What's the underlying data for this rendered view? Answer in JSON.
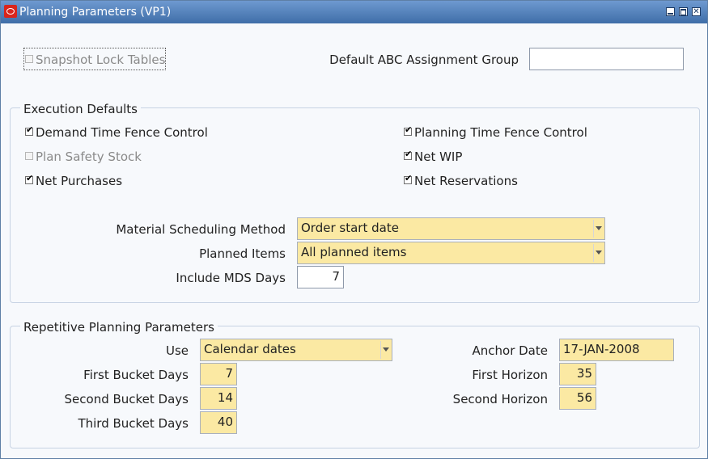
{
  "window": {
    "title": "Planning Parameters (VP1)"
  },
  "top": {
    "snapshot_lock_tables": {
      "label": "Snapshot Lock Tables",
      "checked": false
    },
    "abc_group": {
      "label": "Default ABC Assignment Group",
      "value": ""
    }
  },
  "execution_defaults": {
    "legend": "Execution Defaults",
    "checkboxes": [
      {
        "label": "Demand Time Fence Control",
        "checked": true
      },
      {
        "label": "Planning Time Fence Control",
        "checked": true
      },
      {
        "label": "Plan Safety Stock",
        "checked": false
      },
      {
        "label": "Net WIP",
        "checked": true
      },
      {
        "label": "Net Purchases",
        "checked": true
      },
      {
        "label": "Net Reservations",
        "checked": true
      }
    ],
    "material_scheduling_method": {
      "label": "Material Scheduling Method",
      "value": "Order start date"
    },
    "planned_items": {
      "label": "Planned Items",
      "value": "All planned items"
    },
    "include_mds_days": {
      "label": "Include MDS Days",
      "value": "7"
    }
  },
  "repetitive": {
    "legend": "Repetitive Planning Parameters",
    "use": {
      "label": "Use",
      "value": "Calendar dates"
    },
    "anchor_date": {
      "label": "Anchor Date",
      "value": "17-JAN-2008"
    },
    "first_bucket_days": {
      "label": "First Bucket Days",
      "value": "7"
    },
    "first_horizon": {
      "label": "First Horizon",
      "value": "35"
    },
    "second_bucket_days": {
      "label": "Second Bucket Days",
      "value": "14"
    },
    "second_horizon": {
      "label": "Second Horizon",
      "value": "56"
    },
    "third_bucket_days": {
      "label": "Third Bucket Days",
      "value": "40"
    }
  },
  "check_glyph": "✔"
}
